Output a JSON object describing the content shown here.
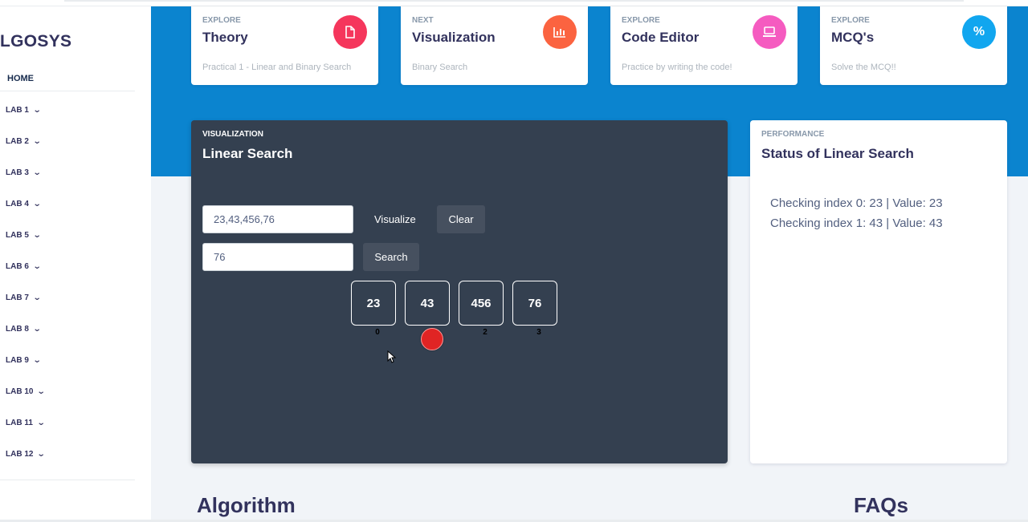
{
  "sidebar": {
    "brand": "LGOSYS",
    "home_label": "HOME",
    "labs": [
      "LAB 1",
      "LAB 2",
      "LAB 3",
      "LAB 4",
      "LAB 5",
      "LAB 6",
      "LAB 7",
      "LAB 8",
      "LAB 9",
      "LAB 10",
      "LAB 11",
      "LAB 12"
    ]
  },
  "cards": [
    {
      "kicker": "EXPLORE",
      "title": "Theory",
      "sub": "Practical 1 - Linear and Binary Search",
      "icon": "document-icon",
      "color": "#f5365c"
    },
    {
      "kicker": "NEXT",
      "title": "Visualization",
      "sub": "Binary Search",
      "icon": "chart-bar-icon",
      "color": "#fb6340"
    },
    {
      "kicker": "EXPLORE",
      "title": "Code Editor",
      "sub": "Practice by writing the code!",
      "icon": "laptop-icon",
      "color": "#f3a4b5"
    },
    {
      "kicker": "EXPLORE",
      "title": "MCQ's",
      "sub": "Solve the MCQ!!",
      "icon": "percent-icon",
      "color": "#11cdef"
    }
  ],
  "viz": {
    "kicker": "VISUALIZATION",
    "title": "Linear Search",
    "array_input_value": "23,43,456,76",
    "visualize_label": "Visualize",
    "clear_label": "Clear",
    "search_input_value": "76",
    "search_label": "Search",
    "cells": [
      "23",
      "43",
      "456",
      "76"
    ],
    "indices": [
      "0",
      "1",
      "2",
      "3"
    ],
    "current_index": 1
  },
  "perf": {
    "kicker": "PERFORMANCE",
    "title": "Status of Linear Search",
    "log": [
      "Checking index 0: 23 | Value: 23",
      "Checking index 1: 43 | Value: 43"
    ]
  },
  "sections": {
    "algorithm": "Algorithm",
    "faqs": "FAQs"
  },
  "colors": {
    "header_blue": "#0b84cf",
    "panel_dark": "#344050",
    "pointer_red": "#e02424"
  }
}
